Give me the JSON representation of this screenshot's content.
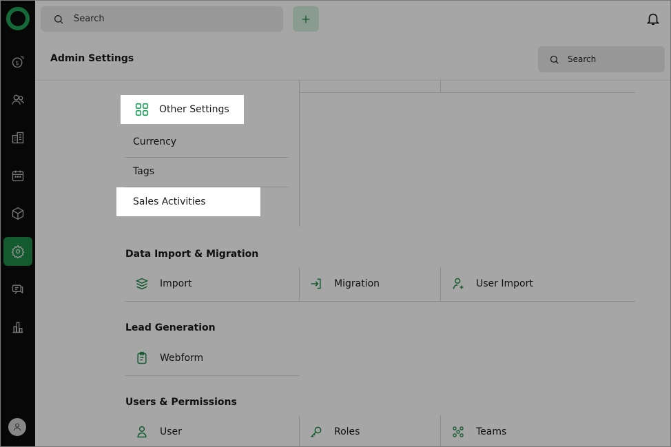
{
  "topbar": {
    "search_label": "Search"
  },
  "header": {
    "title": "Admin Settings",
    "search_label": "Search"
  },
  "other_settings": {
    "highlighted_item": "Other Settings",
    "items": [
      "Currency",
      "Tags",
      "Sales Activities"
    ]
  },
  "data_import": {
    "title": "Data Import & Migration",
    "tiles": [
      "Import",
      "Migration",
      "User Import"
    ]
  },
  "lead_generation": {
    "title": "Lead Generation",
    "tiles": [
      "Webform"
    ]
  },
  "users_permissions": {
    "title": "Users & Permissions",
    "tiles": [
      "User",
      "Roles",
      "Teams"
    ]
  },
  "colors": {
    "accent": "#22a45a",
    "rail": "#0b0b0b",
    "active_rail": "#1f8a49"
  },
  "icons": {
    "rail": [
      "dollar-icon",
      "contacts-icon",
      "buildings-icon",
      "calendar-icon",
      "box-icon",
      "gear-icon",
      "chat-icon",
      "chart-icon"
    ]
  }
}
